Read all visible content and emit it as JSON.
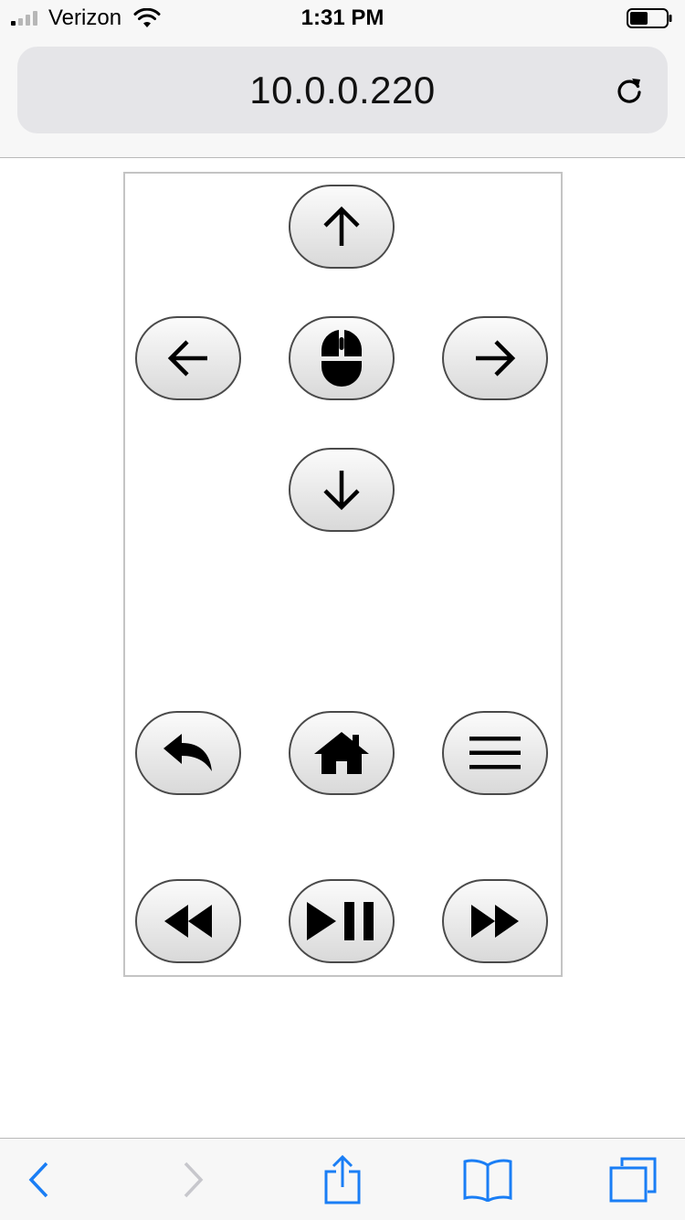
{
  "status_bar": {
    "carrier": "Verizon",
    "time": "1:31 PM",
    "signal_icon": "signal-bars-icon",
    "wifi_icon": "wifi-icon",
    "battery_icon": "battery-icon",
    "battery_level": 0.5
  },
  "browser": {
    "url": "10.0.0.220",
    "reload_icon": "reload-icon"
  },
  "remote": {
    "buttons": [
      {
        "name": "up-button",
        "icon": "arrow-up-icon"
      },
      {
        "name": "left-button",
        "icon": "arrow-left-icon"
      },
      {
        "name": "mouse-button",
        "icon": "mouse-icon"
      },
      {
        "name": "right-button",
        "icon": "arrow-right-icon"
      },
      {
        "name": "down-button",
        "icon": "arrow-down-icon"
      },
      {
        "name": "back-button",
        "icon": "reply-arrow-icon"
      },
      {
        "name": "home-button",
        "icon": "home-icon"
      },
      {
        "name": "menu-button",
        "icon": "hamburger-menu-icon"
      },
      {
        "name": "rewind-button",
        "icon": "rewind-icon"
      },
      {
        "name": "play-pause-button",
        "icon": "play-pause-icon"
      },
      {
        "name": "fast-forward-button",
        "icon": "fast-forward-icon"
      }
    ]
  },
  "toolbar": {
    "items": [
      {
        "name": "back-nav-button",
        "icon": "chevron-left-icon",
        "enabled": true
      },
      {
        "name": "forward-nav-button",
        "icon": "chevron-right-icon",
        "enabled": false
      },
      {
        "name": "share-button",
        "icon": "share-icon",
        "enabled": true
      },
      {
        "name": "bookmarks-button",
        "icon": "book-icon",
        "enabled": true
      },
      {
        "name": "tabs-button",
        "icon": "tabs-icon",
        "enabled": true
      }
    ]
  },
  "colors": {
    "accent": "#1a7ef5",
    "disabled": "#c7c7cc",
    "button_border": "#4a4a4a"
  }
}
